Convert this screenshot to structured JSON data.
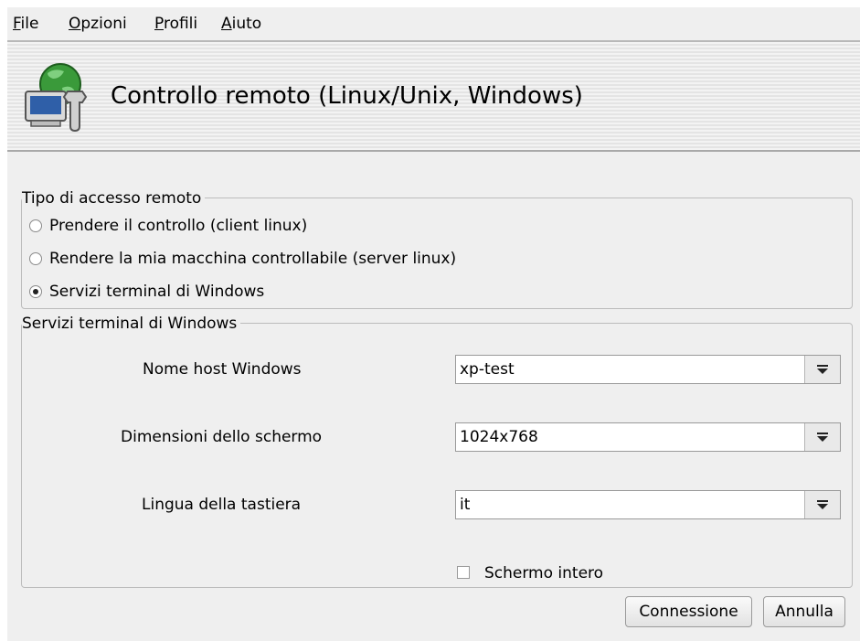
{
  "menu": {
    "file": "File",
    "options": "Opzioni",
    "profiles": "Profili",
    "help": "Aiuto"
  },
  "header": {
    "title": "Controllo remoto (Linux/Unix, Windows)"
  },
  "access_type": {
    "title": "Tipo di accesso remoto",
    "options": [
      {
        "label": "Prendere il controllo (client linux)",
        "selected": false
      },
      {
        "label": "Rendere la mia macchina controllabile (server linux)",
        "selected": false
      },
      {
        "label": "Servizi terminal di Windows",
        "selected": true
      }
    ]
  },
  "terminal_services": {
    "title": "Servizi terminal di Windows",
    "hostname_label": "Nome host Windows",
    "hostname_value": "xp-test",
    "screen_label": "Dimensioni dello schermo",
    "screen_value": "1024x768",
    "keyboard_label": "Lingua della tastiera",
    "keyboard_value": "it",
    "fullscreen_label": "Schermo intero",
    "fullscreen_checked": false
  },
  "buttons": {
    "connect": "Connessione",
    "cancel": "Annulla"
  }
}
